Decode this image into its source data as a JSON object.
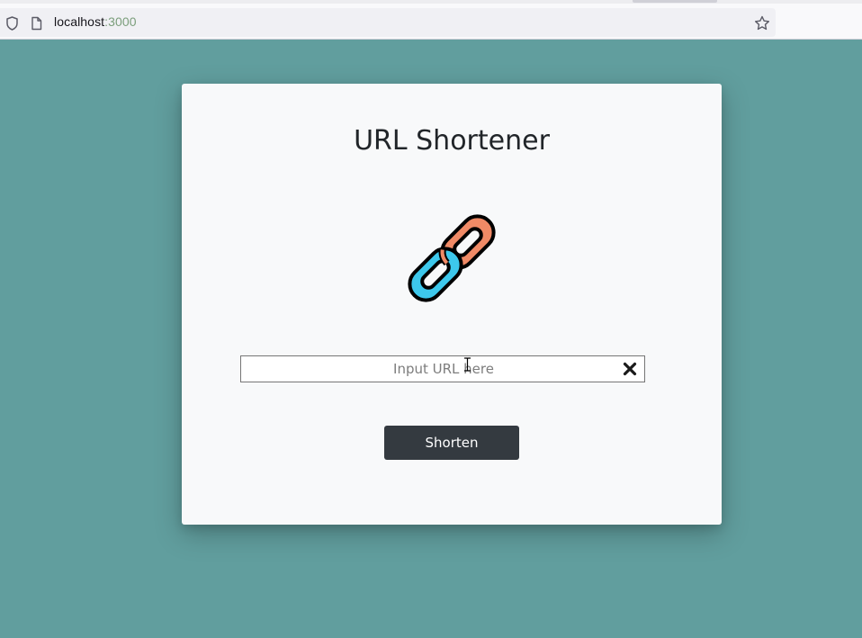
{
  "browser": {
    "url_host": "localhost",
    "url_port": ":3000"
  },
  "card": {
    "title": "URL Shortener",
    "input_placeholder": "Input URL here",
    "input_value": "",
    "button_label": "Shorten"
  },
  "colors": {
    "page_background": "#619e9e",
    "card_background": "#f8f9fa",
    "button_background": "#343a40",
    "chain_orange": "#f08a66",
    "chain_blue": "#3dc8ec"
  },
  "icons": {
    "shield": "shield-icon",
    "page": "page-icon",
    "star": "bookmark-star-icon",
    "logo": "chain-link-icon",
    "clear": "close-icon"
  }
}
